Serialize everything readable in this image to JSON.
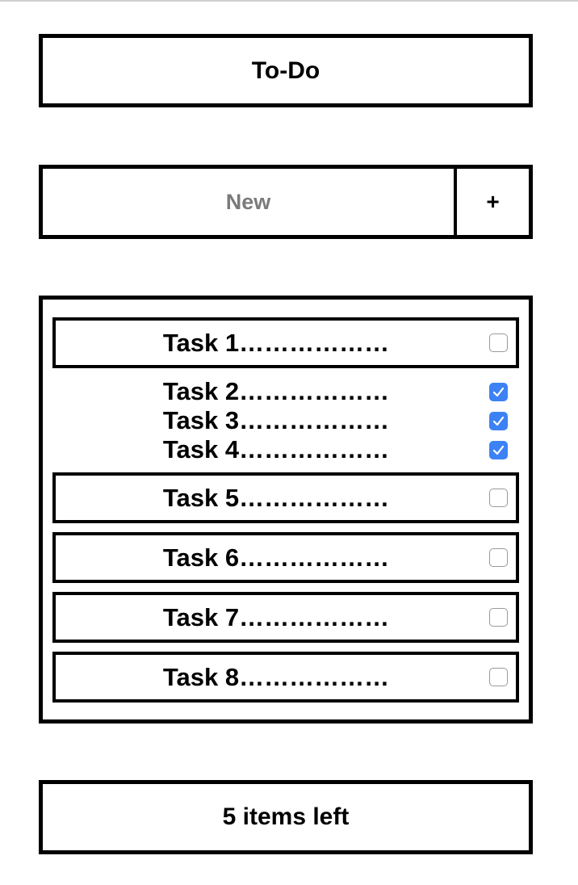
{
  "header": {
    "title": "To-Do"
  },
  "new_task": {
    "placeholder": "New",
    "value": "",
    "add_label": "+"
  },
  "tasks": [
    {
      "label": "Task 1………………",
      "done": false
    },
    {
      "label": "Task 2………………",
      "done": true
    },
    {
      "label": "Task 3………………",
      "done": true
    },
    {
      "label": "Task 4………………",
      "done": true
    },
    {
      "label": "Task 5………………",
      "done": false
    },
    {
      "label": "Task 6………………",
      "done": false
    },
    {
      "label": "Task 7………………",
      "done": false
    },
    {
      "label": "Task 8………………",
      "done": false
    }
  ],
  "footer": {
    "items_left": "5 items left"
  },
  "colors": {
    "border": "#000000",
    "checkbox_checked": "#3d82f4",
    "placeholder": "#7a7a7a"
  }
}
